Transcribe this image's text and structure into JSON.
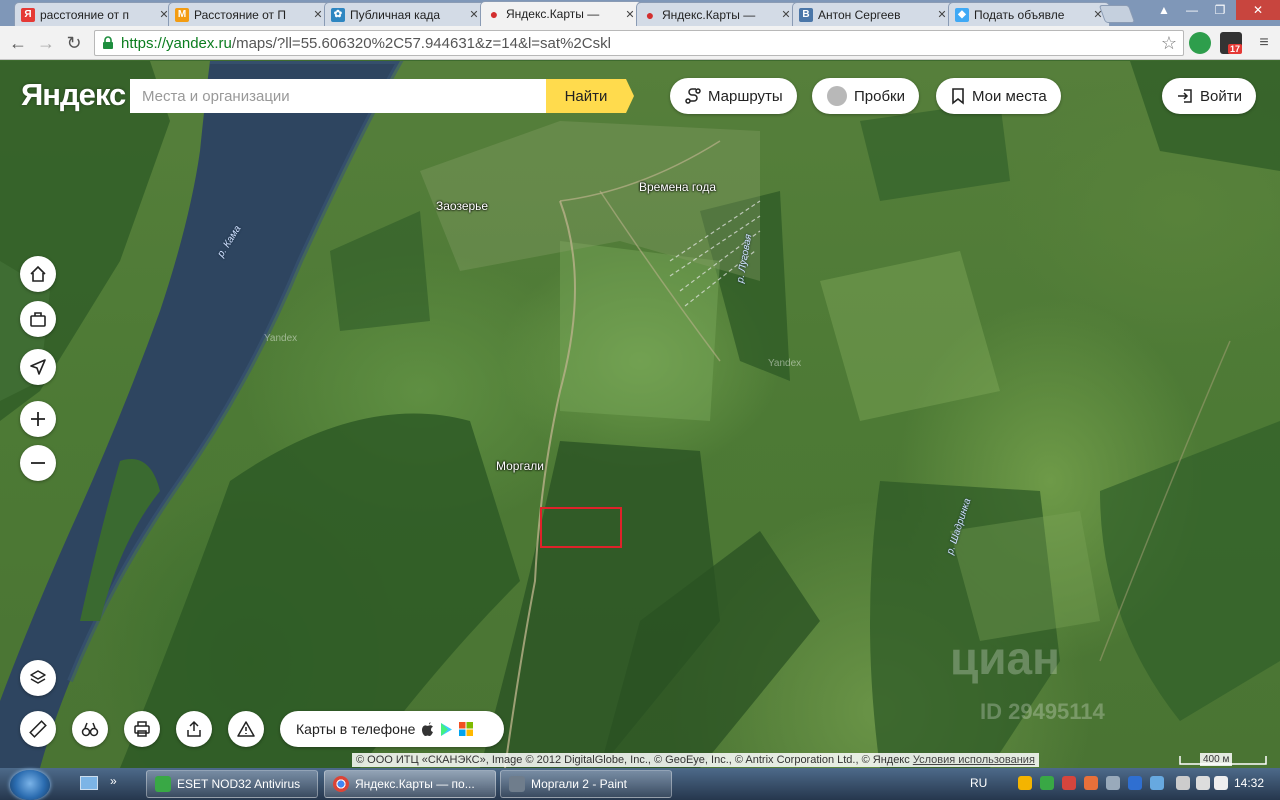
{
  "browser": {
    "tabs": [
      {
        "title": "расстояние от п",
        "favicon": "yandex-icon",
        "color": "#e53935"
      },
      {
        "title": "Расстояние от П",
        "favicon": "page-icon",
        "color": "#f39c12"
      },
      {
        "title": "Публичная када",
        "favicon": "cadastral-icon",
        "color": "#2e86c1"
      },
      {
        "title": "Яндекс.Карты —",
        "favicon": "map-pin-icon",
        "color": "#d32f2f"
      },
      {
        "title": "Яндекс.Карты —",
        "favicon": "map-pin-icon",
        "color": "#d32f2f"
      },
      {
        "title": "Антон Сергеев",
        "favicon": "vk-icon",
        "color": "#4a76a8"
      },
      {
        "title": "Подать объявле",
        "favicon": "ads-icon",
        "color": "#3fa9f5"
      }
    ],
    "url_secure": "https://yandex.ru",
    "url_rest": "/maps/?ll=55.606320%2C57.944631&z=14&l=sat%2Cskl",
    "extension_badge": "17"
  },
  "map": {
    "logo": "Яндекс",
    "search_placeholder": "Места и организации",
    "search_button": "Найти",
    "buttons": {
      "routes": "Маршруты",
      "traffic": "Пробки",
      "my_places": "Мои места",
      "login": "Войти"
    },
    "labels": {
      "zaozerye": "Заозерье",
      "vremena_goda": "Времена года",
      "morgali": "Моргали",
      "river_kama": "р. Кама",
      "river_lugovaya": "р. Луговая",
      "river_shadrinka": "р. Шадринка",
      "watermark1": "Yandex",
      "watermark2": "Yandex"
    },
    "phone_promo": "Карты в телефоне",
    "copyright": "© ООО ИТЦ «СКАНЭКС», Image © 2012 DigitalGlobe, Inc., © GeoEye, Inc., © Antrix Corporation Ltd., © Яндекс",
    "terms": "Условия использования",
    "scale": "400 м",
    "overlay_brand": "циан",
    "overlay_id": "ID 29495114"
  },
  "taskbar": {
    "items": [
      {
        "label": "ESET NOD32 Antivirus",
        "color": "#39a845"
      },
      {
        "label": "Яндекс.Карты — по...",
        "color": "#e0a63a"
      },
      {
        "label": "Моргали 2 - Paint",
        "color": "#6f7d8c"
      }
    ],
    "language": "RU",
    "clock": "14:32"
  }
}
